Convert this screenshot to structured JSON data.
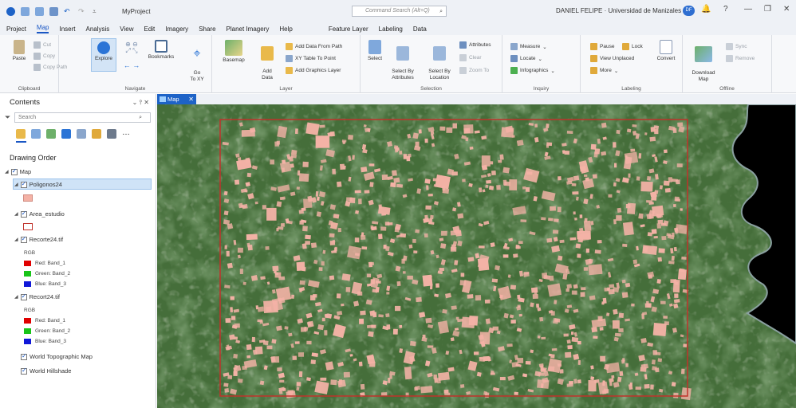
{
  "titlebar": {
    "project": "MyProject",
    "command_search": "Command Search (Alt+Q)",
    "user": "DANIEL FELIPE  · Universidad de Manizales",
    "user_initials": "DF",
    "bell": "🔔",
    "help": "?",
    "minimize": "—",
    "maximize": "❐",
    "close": "✕"
  },
  "tabs": [
    "Project",
    "Map",
    "Insert",
    "Analysis",
    "View",
    "Edit",
    "Imagery",
    "Share",
    "Planet Imagery",
    "Help",
    "Feature Layer",
    "Labeling",
    "Data"
  ],
  "active_tab": "Map",
  "ribbon": {
    "clipboard": {
      "label": "Clipboard",
      "paste": "Paste",
      "cut": "Cut",
      "copy": "Copy",
      "copy_path": "Copy Path"
    },
    "navigate": {
      "label": "Navigate",
      "explore": "Explore",
      "bookmarks": "Bookmarks",
      "goto": "Go\nTo XY"
    },
    "layer": {
      "label": "Layer",
      "basemap": "Basemap",
      "add_data": "Add\nData",
      "add_from_path": "Add Data From Path",
      "xy_table": "XY Table To Point",
      "add_graphics": "Add Graphics Layer"
    },
    "selection": {
      "label": "Selection",
      "select": "Select",
      "by_attr": "Select By\nAttributes",
      "by_loc": "Select By\nLocation",
      "attributes": "Attributes",
      "clear": "Clear",
      "zoom_to": "Zoom To"
    },
    "inquiry": {
      "label": "Inquiry",
      "measure": "Measure",
      "locate": "Locate",
      "infographics": "Infographics"
    },
    "labeling": {
      "label": "Labeling",
      "pause": "Pause",
      "lock": "Lock",
      "view_unplaced": "View Unplaced",
      "more": "More",
      "convert": "Convert"
    },
    "offline": {
      "label": "Offline",
      "download": "Download\nMap",
      "sync": "Sync",
      "remove": "Remove"
    }
  },
  "contents": {
    "title": "Contents",
    "controls": "⌄ ⫯ ✕",
    "search_placeholder": "Search",
    "drawing_order": "Drawing Order",
    "layers": {
      "map": "Map",
      "poligonos": "Poligonos24",
      "area": "Area_estudio",
      "recorte": "Recorte24.tif",
      "rgb1": "RGB",
      "red1": "Red: Band_1",
      "green1": "Green: Band_2",
      "blue1": "Blue: Band_3",
      "recort": "Recort24.tif",
      "rgb2": "RGB",
      "red2": "Red: Band_1",
      "green2": "Green: Band_2",
      "blue2": "Blue: Band_3",
      "topo": "World Topographic Map",
      "hillshade": "World Hillshade"
    }
  },
  "map": {
    "tab_label": "Map",
    "tab_close": "✕"
  },
  "colors": {
    "accent": "#1a57c4",
    "polygon_fill": "#f4b2a6",
    "study_area": "#c0322b"
  }
}
